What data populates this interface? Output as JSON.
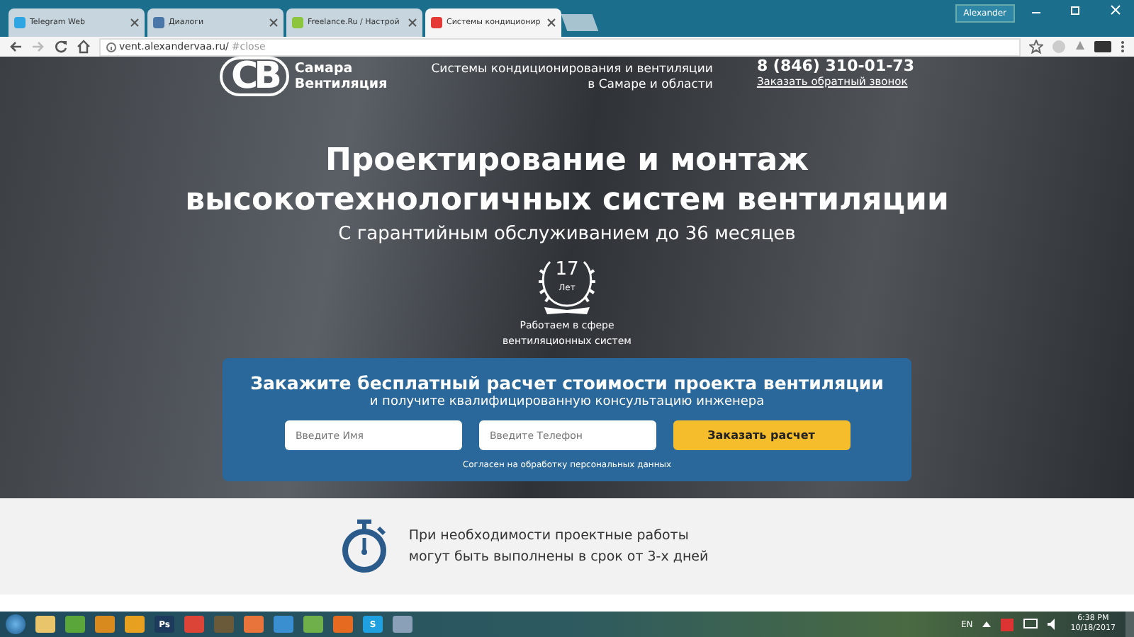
{
  "browser": {
    "tabs": [
      {
        "title": "Telegram Web",
        "selected": false,
        "color": "#2ea6df"
      },
      {
        "title": "Диалоги",
        "selected": false,
        "color": "#4a76a8"
      },
      {
        "title": "Freelance.Ru / Настрой",
        "selected": false,
        "color": "#8cc63f"
      },
      {
        "title": "Системы кондиционир",
        "selected": true,
        "color": "#e53935"
      }
    ],
    "user": "Alexander",
    "url": "vent.alexandervaa.ru/",
    "url_hash": "#close"
  },
  "header": {
    "logo_mark": "СВ",
    "logo_lines": [
      "Самара",
      "Вентиляция"
    ],
    "tagline": [
      "Системы кондиционирования и вентиляции",
      "в Самаре и области"
    ],
    "phone": "8 (846) 310-01-73",
    "callback_link": "Заказать обратный звонок"
  },
  "hero": {
    "title": [
      "Проектирование и монтаж",
      "высокотехнологичных систем вентиляции"
    ],
    "subtitle": "С гарантийным обслуживанием до 36 месяцев",
    "badge_number": "17",
    "badge_unit": "Лет",
    "badge_caption": [
      "Работаем в сфере",
      "вентиляционных систем"
    ]
  },
  "form": {
    "title": "Закажите бесплатный расчет стоимости проекта вентиляции",
    "subtitle": "и получите квалифицированную консультацию инженера",
    "fields": [
      {
        "placeholder": "Введите Имя"
      },
      {
        "placeholder": "Введите Телефон"
      }
    ],
    "submit": "Заказать расчет",
    "consent": "Согласен на обработку персональных данных"
  },
  "feature": {
    "lines": [
      "При необходимости проектные работы",
      "могут быть выполнены в срок от 3-х дней"
    ]
  },
  "taskbar": {
    "apps": [
      {
        "color": "#e8c56a"
      },
      {
        "color": "#5aa63a"
      },
      {
        "color": "#d98a1e"
      },
      {
        "color": "#e8a020"
      },
      {
        "color": "#1d3a5c",
        "label": "Ps"
      },
      {
        "color": "#db4437"
      },
      {
        "color": "#6b5a3a"
      },
      {
        "color": "#e8743b"
      },
      {
        "color": "#3a8fd0"
      },
      {
        "color": "#6fb04a"
      },
      {
        "color": "#e66a1f"
      },
      {
        "color": "#1fa0e0",
        "label": "S"
      },
      {
        "color": "#8aa0b8"
      }
    ],
    "lang": "EN",
    "time": "6:38 PM",
    "date": "10/18/2017"
  }
}
